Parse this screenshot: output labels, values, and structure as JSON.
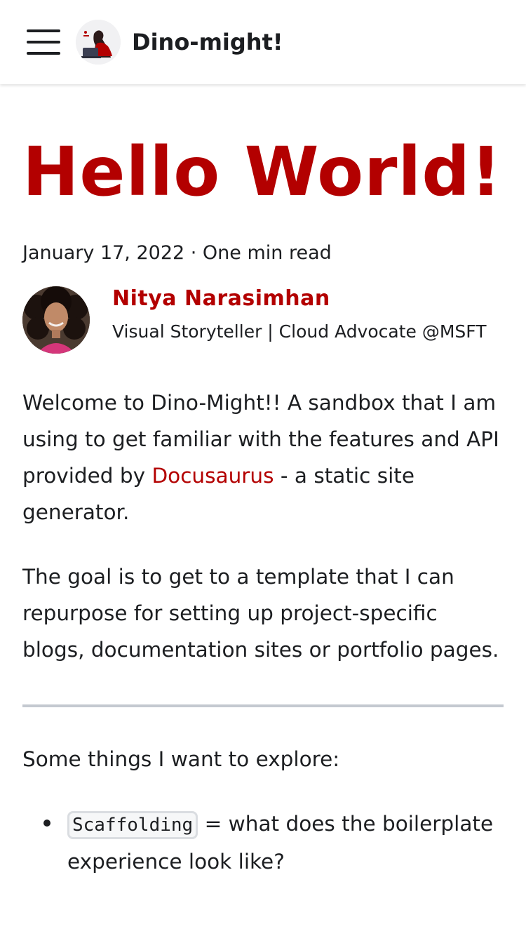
{
  "header": {
    "site_title": "Dino-might!",
    "menu_icon": "hamburger-menu-icon",
    "logo": "dino-might-logo"
  },
  "post": {
    "title": "Hello World!",
    "meta": "January 17, 2022 · One min read",
    "author": {
      "name": "Nitya Narasimhan",
      "bio": "Visual Storyteller | Cloud Advocate @MSFT"
    },
    "paragraph1_before": "Welcome to Dino-Might!! A sandbox that I am using to get familiar with the features and API provided by ",
    "paragraph1_link": "Docusaurus",
    "paragraph1_after": " - a static site generator.",
    "paragraph2": "The goal is to get to a template that I can repurpose for setting up project-specific blogs, documentation sites or portfolio pages.",
    "paragraph3": "Some things I want to explore:",
    "list": [
      {
        "code": "Scaffolding",
        "text": " = what does the boilerplate experience look like?"
      }
    ]
  },
  "colors": {
    "accent": "#b30000",
    "text": "#1c1e21",
    "divider": "#c4c9d0",
    "code_bg": "#f6f7f8"
  }
}
